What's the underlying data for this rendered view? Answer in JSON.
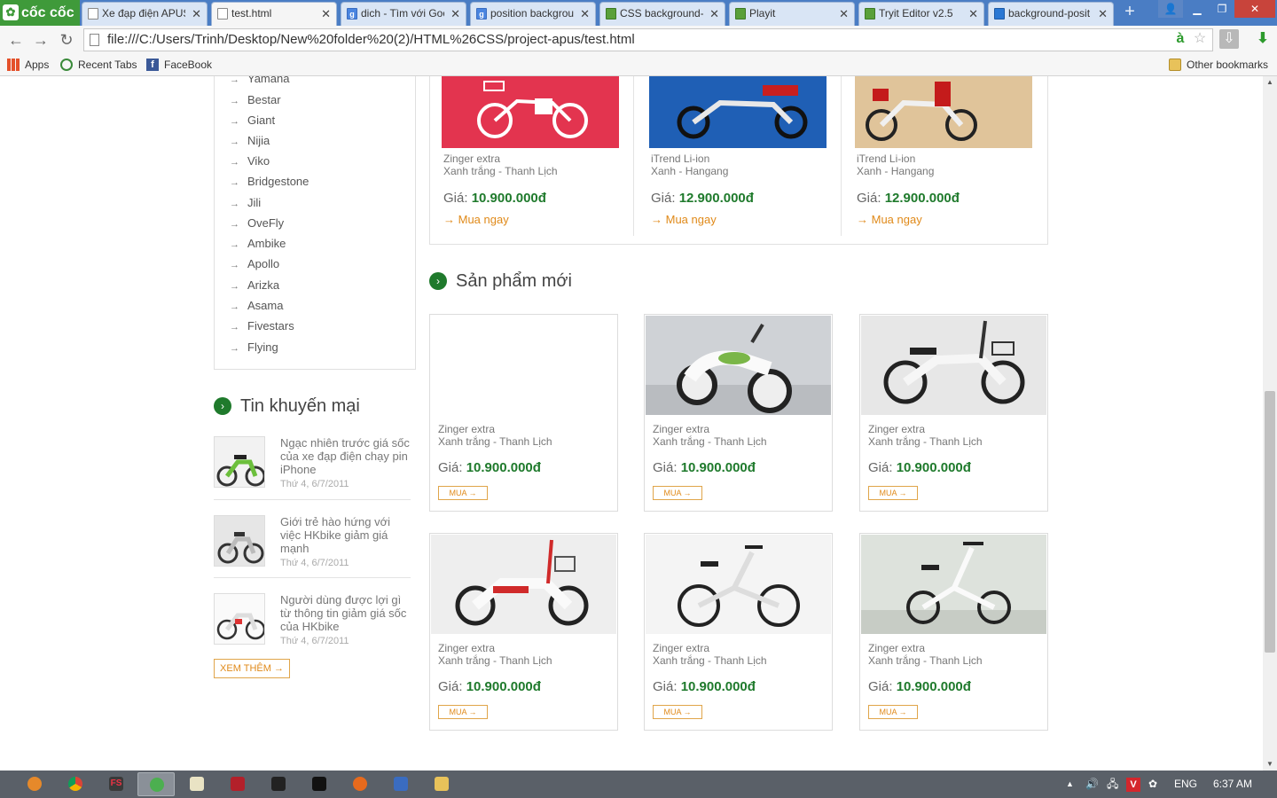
{
  "browser": {
    "logo": "cốc cốc",
    "tabs": [
      {
        "label": "Xe đạp điện APUS",
        "icon": "page-icon"
      },
      {
        "label": "test.html",
        "icon": "page-icon",
        "active": true
      },
      {
        "label": "dich - Tìm với Goo",
        "icon": "google-icon"
      },
      {
        "label": "position backgrou",
        "icon": "google-icon"
      },
      {
        "label": "CSS background-p",
        "icon": "w3schools-icon"
      },
      {
        "label": "Playit",
        "icon": "w3schools-icon"
      },
      {
        "label": "Tryit Editor v2.5",
        "icon": "w3schools-icon"
      },
      {
        "label": "background-posit",
        "icon": "postman-icon"
      }
    ],
    "url": "file:///C:/Users/Trinh/Desktop/New%20folder%20(2)/HTML%26CSS/project-apus/test.html",
    "bookmarks": {
      "apps": "Apps",
      "recent": "Recent Tabs",
      "facebook": "FaceBook",
      "other": "Other bookmarks"
    }
  },
  "sidebar": {
    "brands": [
      "Yamaha",
      "Bestar",
      "Giant",
      "Nijia",
      "Viko",
      "Bridgestone",
      "Jili",
      "OveFly",
      "Ambike",
      "Apollo",
      "Arizka",
      "Asama",
      "Fivestars",
      "Flying"
    ],
    "news_title": "Tin khuyến mại",
    "news": [
      {
        "title": "Ngạc nhiên trước giá sốc của xe đạp điện chạy pin iPhone",
        "date": "Thứ 4, 6/7/2011"
      },
      {
        "title": "Giới trẻ hào hứng với việc HKbike giảm giá mạnh",
        "date": "Thứ 4, 6/7/2011"
      },
      {
        "title": "Người dùng được lợi gì từ thông tin giảm giá sốc của HKbike",
        "date": "Thứ 4, 6/7/2011"
      }
    ],
    "more_label": "XEM THÊM →"
  },
  "featured": [
    {
      "name1": "Zinger extra",
      "name2": "Xanh trắng - Thanh Lịch",
      "price_label": "Giá:",
      "price": "10.900.000đ",
      "buy": "Mua ngay",
      "image": "red-electric-bike"
    },
    {
      "name1": "iTrend Li-ion",
      "name2": "Xanh - Hangang",
      "price_label": "Giá:",
      "price": "12.900.000đ",
      "buy": "Mua ngay",
      "image": "blue-electric-scooter"
    },
    {
      "name1": "iTrend Li-ion",
      "name2": "Xanh - Hangang",
      "price_label": "Giá:",
      "price": "12.900.000đ",
      "buy": "Mua ngay",
      "image": "red-bike-desert"
    }
  ],
  "new_products": {
    "title": "Sản phẩm mới",
    "items": [
      {
        "name1": "Zinger extra",
        "name2": "Xanh trắng - Thanh Lịch",
        "price_label": "Giá:",
        "price": "10.900.000đ",
        "buy": "MUA →",
        "image": "blank"
      },
      {
        "name1": "Zinger extra",
        "name2": "Xanh trắng - Thanh Lịch",
        "price_label": "Giá:",
        "price": "10.900.000đ",
        "buy": "MUA →",
        "image": "white-scooter"
      },
      {
        "name1": "Zinger extra",
        "name2": "Xanh trắng - Thanh Lịch",
        "price_label": "Giá:",
        "price": "10.900.000đ",
        "buy": "MUA →",
        "image": "white-electric-bike"
      },
      {
        "name1": "Zinger extra",
        "name2": "Xanh trắng - Thanh Lịch",
        "price_label": "Giá:",
        "price": "10.900.000đ",
        "buy": "MUA →",
        "image": "red-white-electric-bike"
      },
      {
        "name1": "Zinger extra",
        "name2": "Xanh trắng - Thanh Lịch",
        "price_label": "Giá:",
        "price": "10.900.000đ",
        "buy": "MUA →",
        "image": "folding-bike"
      },
      {
        "name1": "Zinger extra",
        "name2": "Xanh trắng - Thanh Lịch",
        "price_label": "Giá:",
        "price": "10.900.000đ",
        "buy": "MUA →",
        "image": "white-folding-bike"
      }
    ]
  },
  "taskbar": {
    "lang": "ENG",
    "time": "6:37 AM"
  }
}
